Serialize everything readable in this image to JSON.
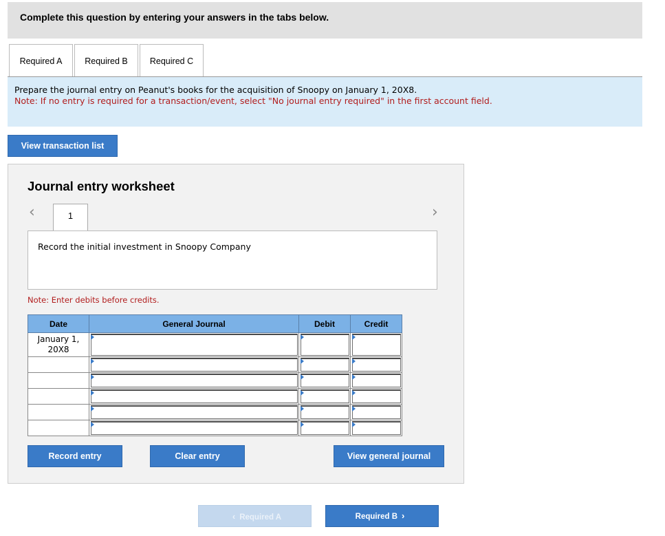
{
  "header": {
    "instruction": "Complete this question by entering your answers in the tabs below."
  },
  "tabs": [
    {
      "label": "Required A",
      "active": true
    },
    {
      "label": "Required B",
      "active": false
    },
    {
      "label": "Required C",
      "active": false
    }
  ],
  "instructions": {
    "text": "Prepare the journal entry on Peanut's books for the acquisition of Snoopy on January 1, 20X8.",
    "note": "Note: If no entry is required for a transaction/event, select \"No journal entry required\" in the first account field."
  },
  "view_transaction_list_label": "View transaction list",
  "worksheet": {
    "title": "Journal entry worksheet",
    "prev_icon": "chevron-left-icon",
    "next_icon": "chevron-right-icon",
    "prev_glyph": "‹",
    "next_glyph": "›",
    "current_page": "1",
    "description": "Record the initial investment in Snoopy Company",
    "note": "Note: Enter debits before credits.",
    "table": {
      "headers": {
        "date": "Date",
        "journal": "General Journal",
        "debit": "Debit",
        "credit": "Credit"
      },
      "rows": [
        {
          "date_line1": "January 1,",
          "date_line2": "20X8"
        },
        {
          "date_line1": "",
          "date_line2": ""
        },
        {
          "date_line1": "",
          "date_line2": ""
        },
        {
          "date_line1": "",
          "date_line2": ""
        },
        {
          "date_line1": "",
          "date_line2": ""
        },
        {
          "date_line1": "",
          "date_line2": ""
        }
      ]
    },
    "buttons": {
      "record": "Record entry",
      "clear": "Clear entry",
      "view_general_journal": "View general journal"
    }
  },
  "navigation": {
    "prev_label": "Required A",
    "next_label": "Required B",
    "prev_glyph": "‹",
    "next_glyph": "›"
  },
  "colors": {
    "primary_button": "#3a7bc8",
    "table_header": "#7bb1e6",
    "instruction_bg": "#d9ecf9",
    "note_red": "#b11c1c"
  }
}
